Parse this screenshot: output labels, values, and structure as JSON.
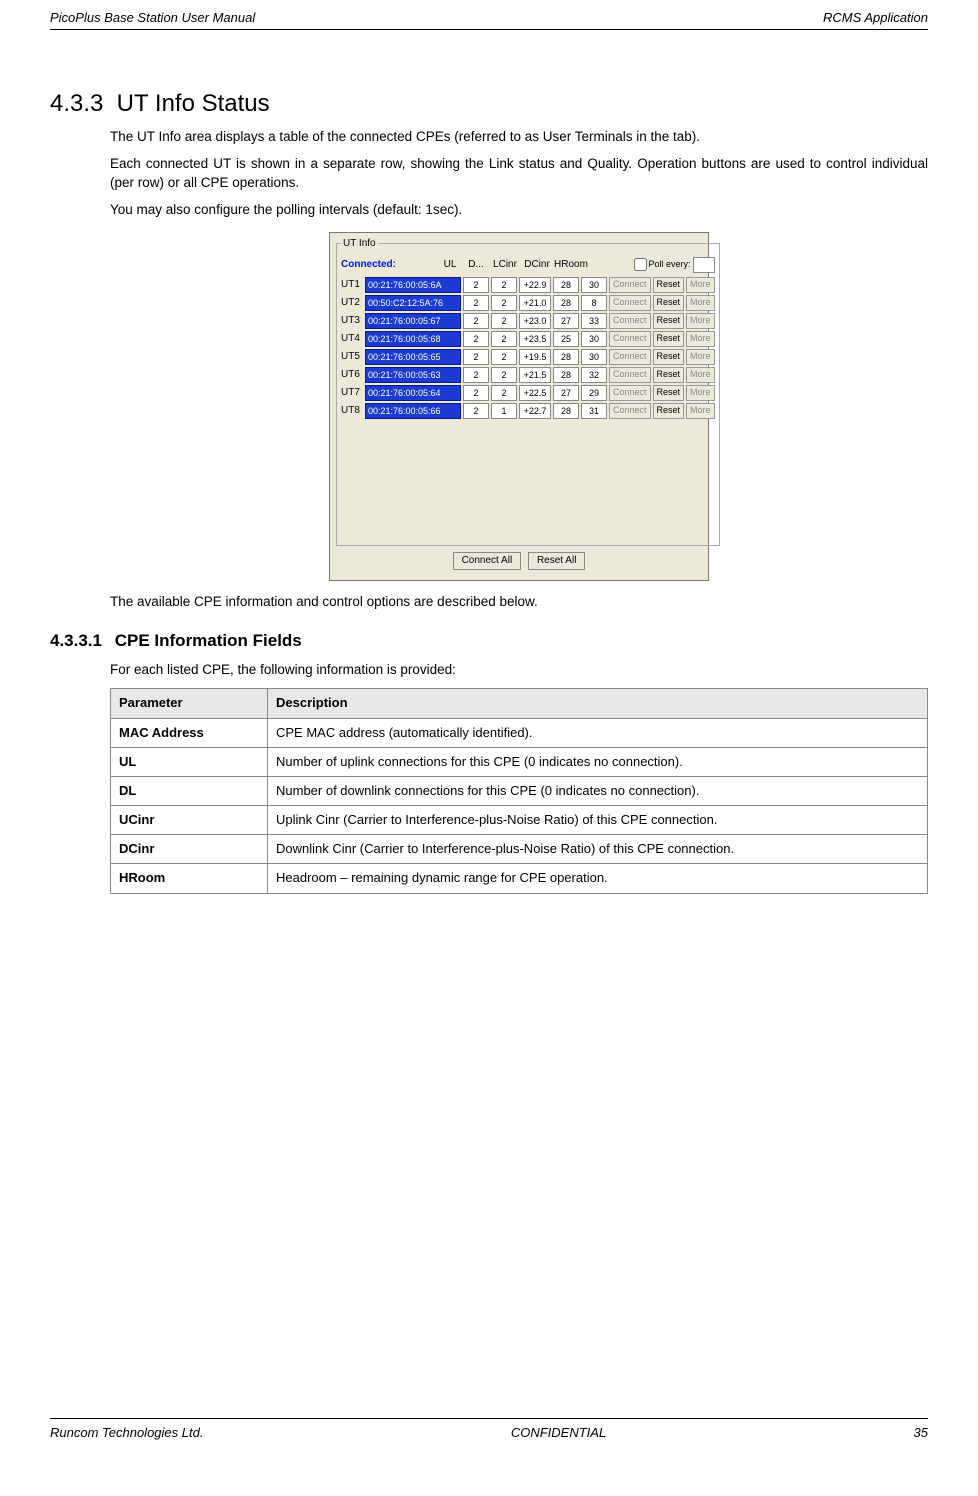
{
  "header": {
    "left": "PicoPlus Base Station User Manual",
    "right": "RCMS Application"
  },
  "footer": {
    "left": "Runcom Technologies Ltd.",
    "center": "CONFIDENTIAL",
    "right": "35"
  },
  "section": {
    "num": "4.3.3",
    "title": "UT Info Status"
  },
  "paragraphs": {
    "p1": "The UT Info area displays a table of the connected CPEs (referred to as User Terminals in the tab).",
    "p2": "Each connected UT is shown in a separate row, showing the Link status and Quality. Operation buttons are used to control individual (per row) or all CPE operations.",
    "p3": "You may also configure the polling intervals (default: 1sec).",
    "p4": "The available CPE information and control options are described below."
  },
  "fig": {
    "legend": "UT Info",
    "connected": "Connected:",
    "cols": [
      "UL",
      "D...",
      "LCinr",
      "DCinr",
      "HRoom"
    ],
    "poll_label": "Poll every:",
    "btn_connect": "Connect",
    "btn_reset": "Reset",
    "btn_more": "More",
    "btn_connect_all": "Connect All",
    "btn_reset_all": "Reset All",
    "rows": [
      {
        "id": "UT1",
        "mac": "00:21:76:00:05:6A",
        "ul": "2",
        "dl": "2",
        "uc": "+22.9",
        "dc": "28",
        "hr": "30"
      },
      {
        "id": "UT2",
        "mac": "00:50:C2:12:5A:76",
        "ul": "2",
        "dl": "2",
        "uc": "+21.0",
        "dc": "28",
        "hr": "8"
      },
      {
        "id": "UT3",
        "mac": "00:21:76:00:05:67",
        "ul": "2",
        "dl": "2",
        "uc": "+23.0",
        "dc": "27",
        "hr": "33"
      },
      {
        "id": "UT4",
        "mac": "00:21:76:00:05:68",
        "ul": "2",
        "dl": "2",
        "uc": "+23.5",
        "dc": "25",
        "hr": "30"
      },
      {
        "id": "UT5",
        "mac": "00:21:76:00:05:65",
        "ul": "2",
        "dl": "2",
        "uc": "+19.5",
        "dc": "28",
        "hr": "30"
      },
      {
        "id": "UT6",
        "mac": "00:21:76:00:05:63",
        "ul": "2",
        "dl": "2",
        "uc": "+21.5",
        "dc": "28",
        "hr": "32"
      },
      {
        "id": "UT7",
        "mac": "00:21:76:00:05:64",
        "ul": "2",
        "dl": "2",
        "uc": "+22.5",
        "dc": "27",
        "hr": "29"
      },
      {
        "id": "UT8",
        "mac": "00:21:76:00:05:66",
        "ul": "2",
        "dl": "1",
        "uc": "+22.7",
        "dc": "28",
        "hr": "31"
      }
    ]
  },
  "subsection": {
    "num": "4.3.3.1",
    "title": "CPE Information Fields"
  },
  "intro_table": "For each listed CPE, the following information is provided:",
  "table": {
    "head_param": "Parameter",
    "head_desc": "Description",
    "rows": [
      {
        "p": "MAC Address",
        "d": "CPE MAC address (automatically identified)."
      },
      {
        "p": "UL",
        "d": "Number of uplink connections for this CPE (0 indicates no connection)."
      },
      {
        "p": "DL",
        "d": "Number of downlink connections for this CPE (0 indicates no connection)."
      },
      {
        "p": "UCinr",
        "d": "Uplink Cinr (Carrier to Interference-plus-Noise Ratio) of this CPE connection."
      },
      {
        "p": "DCinr",
        "d": "Downlink Cinr (Carrier to Interference-plus-Noise Ratio) of this CPE connection."
      },
      {
        "p": "HRoom",
        "d": "Headroom – remaining dynamic range for CPE operation."
      }
    ]
  }
}
